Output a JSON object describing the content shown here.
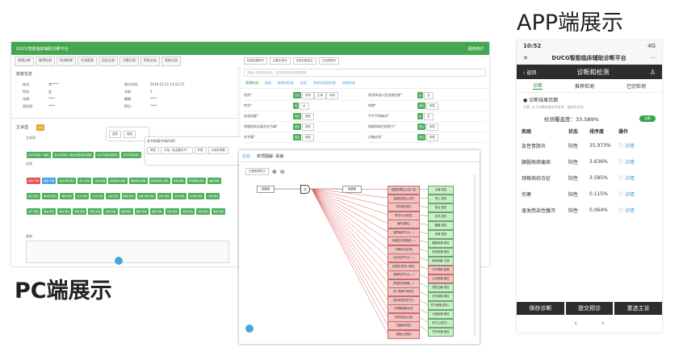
{
  "headings": {
    "app": "APP端展示",
    "pc": "PC端展示"
  },
  "pc": {
    "title": "DUCG智能临床辅助诊断平台",
    "user": "超级用户",
    "tabs": [
      "常规诊断",
      "推荐检测",
      "检测结果",
      "生成图表",
      "历史记录",
      "问题记录",
      "帮助文档",
      "获取记录"
    ],
    "patient_section": "患者信息",
    "patient_fields": [
      {
        "label": "姓名:",
        "value": "李****"
      },
      {
        "label": "性别:",
        "value": "女"
      },
      {
        "label": "年龄:",
        "value": "****"
      },
      {
        "label": "居住地:",
        "value": "****"
      }
    ],
    "patient_fields_right": [
      {
        "label": "就诊时间:",
        "value": "2019-12-15 14:51:27"
      },
      {
        "label": "年龄:",
        "value": "3"
      },
      {
        "label": "婚姻:",
        "value": "****"
      },
      {
        "label": "职位:",
        "value": "****"
      }
    ],
    "complaint_section": "主诉选",
    "complaint_badge": "主诉",
    "main_symptoms_label": "主诉项",
    "main_symptoms": [
      "手关节疼痛(一般型)",
      "手关节疼痛(一般性)局部疼痛(颈部)",
      "手关节疼痛(有明显)",
      "手关节疼痛(有)"
    ],
    "required_label": "必选",
    "required_tags": [
      "发热-不明",
      "咳嗽-不明",
      "有关节痛-阳性",
      "恶心-阳性",
      "头晕-阳性",
      "肝脏病史-阳性",
      "肾脏病史-阳性",
      "持续性呕吐-阳性",
      "皮疹-阳性",
      "呼吸困难-阳性",
      "咽痛-阳性",
      "腹泻-阳性",
      "肌肉痛-阳性",
      "胸闷-阳性",
      "乏力-阳性",
      "口渴-阳性",
      "头痛-阳性",
      "眼痛-阳性",
      "食欲下降-阳性",
      "鼻塞-阳性",
      "流涕-阳性",
      "关节肿-阳性",
      "心悸-阳性",
      "出汗-阳性",
      "咯血-阳性",
      "便血-阳性",
      "尿频-阳性",
      "黄疸-阳性",
      "水肿-阳性",
      "失眠-阳性",
      "腰痛-阳性",
      "颈痛-阳性",
      "背痛-阳性",
      "胃痛-阳性",
      "耳鸣-阳性",
      "眩晕-阳性"
    ],
    "other_label": "其他",
    "popup": {
      "options": [
        "选择",
        "继续"
      ],
      "row_label": "关节疼痛(中轴外侧)",
      "choices": [
        "阴性",
        "中轴（包含腰关节）",
        "外周",
        "中轴外周都"
      ]
    },
    "right_tabs": [
      "检验结果填写",
      "过敏史填写",
      "全部诊断结论",
      "已完成填写"
    ],
    "search_placeholder": "请输入检测项目名称、支持多项目名称模糊搜索",
    "right_subtabs": [
      "常规检测",
      "血液",
      "影像学检查",
      "症状",
      "其他实验室检查",
      "病理检查"
    ],
    "rows": [
      {
        "label": "发热*",
        "opts": [
          "已检",
          "异常",
          "正常",
          "未检"
        ]
      },
      {
        "label": "性别*",
        "opts": [
          "男",
          "女"
        ]
      },
      {
        "label": "体温测量*",
        "opts": [
          "阳性",
          "阴性"
        ]
      },
      {
        "label": "骨骼肌肉压痛及关节痛*",
        "opts": [
          "阳性",
          "阴性"
        ]
      },
      {
        "label": "关节痛*",
        "opts": [
          "阳性",
          "阴性"
        ]
      }
    ],
    "rows_right": [
      {
        "label": "发热体温以及血液检查*",
        "opts": [
          "是",
          "否"
        ]
      },
      {
        "label": "咳嗽*",
        "opts": [
          "阳性",
          "阴性"
        ]
      },
      {
        "label": "手中手指麻木*",
        "opts": [
          "是",
          "否"
        ]
      },
      {
        "label": "咽痛和淋巴结肿大*",
        "opts": [
          "阳性",
          "阴性"
        ]
      },
      {
        "label": "过敏症状*",
        "opts": [
          "阳性",
          "阴性"
        ]
      }
    ]
  },
  "diagram": {
    "tabs": [
      "检验",
      "单项图解: 呆病"
    ],
    "toolbar": "过程推理显示",
    "source_node": "呆腿疼",
    "gate": "D",
    "center_node": "呆腿疼",
    "causes": [
      "强直性脊柱炎(高: 性)",
      "强直性脊柱炎(阳)",
      "类风湿(阳性)",
      "骨关节炎(阳性)",
      "痛风(阳性)",
      "银屑病关节炎(...)",
      "系统性红斑狼疮(...)",
      "干燥综合征(阳)",
      "反应性关节炎(...)",
      "风湿热(发热: 阳性)",
      "肠病性关节炎(...)",
      "风湿性多肌痛(...)",
      "成人斯蒂尔病(阳)",
      "幼年特发性关节炎",
      "纤维肌痛综合征",
      "多发性肌炎(阳)",
      "白塞病(阳性)",
      "血管炎(阳性)"
    ],
    "effects": [
      "头痛-阳性",
      "恶心-阳性",
      "呕吐-阳性",
      "发热-阳性",
      "腰痛-阳性",
      "咳嗽-阳性",
      "腰部疼痛-阳性",
      "肌肉疼痛-阳性",
      "持续疼痛: 红肿",
      "关节肿胀-肌僵",
      "心包疼痛-阳性",
      "阳性过敏-阳性",
      "关节肿胀-阳性",
      "关节疼痛(发热)...",
      "手指疼痛-阳性",
      "关节炎(发热)...",
      "关节疼痛-阳性"
    ]
  },
  "app": {
    "time": "10:52",
    "signal": "4G",
    "title": "DUCG智能临床辅助诊断平台",
    "back": "返回",
    "nav_title": "诊断和检测",
    "tabs": [
      "诊断",
      "推荐检测",
      "已完检测"
    ],
    "diag_page": "诊断结果页面",
    "diag_note": "注意: 以下诊断结果仅供参考，请结合实际",
    "prob_label": "检测覆盖度：33.589%",
    "prob_btn": "诊断",
    "columns": [
      "疾病",
      "状态",
      "排序度",
      "操作"
    ],
    "rows": [
      {
        "disease": "急性胃肠炎",
        "status": "阳性",
        "score": "25.973%",
        "op": "详情"
      },
      {
        "disease": "腰腿病病痛病",
        "status": "阳性",
        "score": "3.636%",
        "op": "详情"
      },
      {
        "disease": "颈椎病综合征",
        "status": "阳性",
        "score": "3.585%",
        "op": "详情"
      },
      {
        "disease": "伤寒",
        "status": "阳性",
        "score": "0.115%",
        "op": "详情"
      },
      {
        "disease": "速发感染性腹泻",
        "status": "阳性",
        "score": "0.064%",
        "op": "详情"
      }
    ],
    "footer": [
      "保存诊断",
      "提交预诊",
      "重选主诉"
    ],
    "nav_prev": "‹",
    "nav_next": "›"
  }
}
